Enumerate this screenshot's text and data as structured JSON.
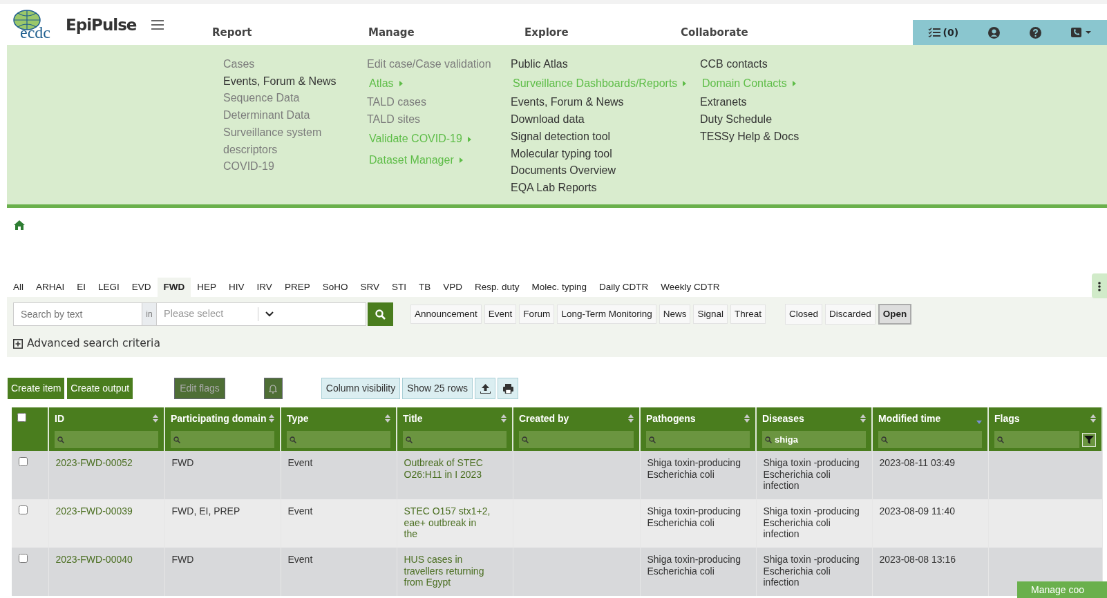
{
  "brand": {
    "logo_text": "ecdc",
    "name": "EpiPulse"
  },
  "menu_heads": [
    "Report",
    "Manage",
    "Explore",
    "Collaborate"
  ],
  "toolbar": {
    "task_count": "(0)"
  },
  "menu_columns": [
    [
      {
        "label": "Cases",
        "kind": "muted"
      },
      {
        "label": "Events, Forum & News",
        "kind": "link"
      },
      {
        "label": "Sequence Data",
        "kind": "muted"
      },
      {
        "label": "Determinant Data",
        "kind": "muted"
      },
      {
        "label": "Surveillance system descriptors",
        "kind": "muted"
      },
      {
        "label": "COVID-19",
        "kind": "muted"
      }
    ],
    [
      {
        "label": "Edit case/Case validation",
        "kind": "muted"
      },
      {
        "label": "Atlas",
        "kind": "submenu"
      },
      {
        "label": "TALD cases",
        "kind": "muted"
      },
      {
        "label": "TALD sites",
        "kind": "muted"
      },
      {
        "label": "Validate COVID-19",
        "kind": "submenu"
      },
      {
        "label": "Dataset Manager",
        "kind": "submenu"
      }
    ],
    [
      {
        "label": "Public Atlas",
        "kind": "link"
      },
      {
        "label": "Surveillance Dashboards/Reports",
        "kind": "submenu"
      },
      {
        "label": "Events, Forum & News",
        "kind": "link"
      },
      {
        "label": "Download data",
        "kind": "link"
      },
      {
        "label": "Signal detection tool",
        "kind": "link"
      },
      {
        "label": "Molecular typing tool",
        "kind": "link"
      },
      {
        "label": "Documents Overview",
        "kind": "link"
      },
      {
        "label": "EQA Lab Reports",
        "kind": "link"
      }
    ],
    [
      {
        "label": "CCB contacts",
        "kind": "link"
      },
      {
        "label": "Domain Contacts",
        "kind": "submenu"
      },
      {
        "label": "Extranets",
        "kind": "link"
      },
      {
        "label": "Duty Schedule",
        "kind": "link"
      },
      {
        "label": "TESSy Help & Docs",
        "kind": "link"
      }
    ]
  ],
  "domain_tabs": [
    {
      "label": "All",
      "selected": false
    },
    {
      "label": "ARHAI",
      "selected": false
    },
    {
      "label": "EI",
      "selected": false
    },
    {
      "label": "LEGI",
      "selected": false
    },
    {
      "label": "EVD",
      "selected": false
    },
    {
      "label": "FWD",
      "selected": true
    },
    {
      "label": "HEP",
      "selected": false
    },
    {
      "label": "HIV",
      "selected": false
    },
    {
      "label": "IRV",
      "selected": false
    },
    {
      "label": "PREP",
      "selected": false
    },
    {
      "label": "SoHO",
      "selected": false
    },
    {
      "label": "SRV",
      "selected": false
    },
    {
      "label": "STI",
      "selected": false
    },
    {
      "label": "TB",
      "selected": false
    },
    {
      "label": "VPD",
      "selected": false
    },
    {
      "label": "Resp. duty",
      "selected": false
    },
    {
      "label": "Molec. typing",
      "selected": false
    },
    {
      "label": "Daily CDTR",
      "selected": false
    },
    {
      "label": "Weekly CDTR",
      "selected": false
    }
  ],
  "search": {
    "placeholder": "Search by text",
    "in_label": "in",
    "select_placeholder": "Please select",
    "advanced": "Advanced search criteria"
  },
  "type_filters": [
    {
      "label": "Announcement",
      "selected": false
    },
    {
      "label": "Event",
      "selected": false
    },
    {
      "label": "Forum",
      "selected": false
    },
    {
      "label": "Long-Term Monitoring",
      "selected": false
    },
    {
      "label": "News",
      "selected": false
    },
    {
      "label": "Signal",
      "selected": false
    },
    {
      "label": "Threat",
      "selected": false
    }
  ],
  "status_filters": [
    {
      "label": "Closed",
      "selected": false
    },
    {
      "label": "Discarded",
      "selected": false
    },
    {
      "label": "Open",
      "selected": true
    }
  ],
  "actions": {
    "create_item": "Create item",
    "create_output": "Create output",
    "edit_flags": "Edit flags",
    "column_visibility": "Column visibility",
    "show_rows": "Show 25 rows"
  },
  "table": {
    "all_checked": false,
    "columns": [
      {
        "label": "ID",
        "sorted_desc": false
      },
      {
        "label": "Participating domain",
        "sorted_desc": false
      },
      {
        "label": "Type",
        "sorted_desc": false
      },
      {
        "label": "Title",
        "sorted_desc": false
      },
      {
        "label": "Created by",
        "sorted_desc": false
      },
      {
        "label": "Pathogens",
        "sorted_desc": false
      },
      {
        "label": "Diseases",
        "sorted_desc": false,
        "filter": "shiga"
      },
      {
        "label": "Modified time",
        "sorted_desc": true
      },
      {
        "label": "Flags",
        "sorted_desc": false
      }
    ],
    "rows": [
      {
        "checked": false,
        "cells": [
          "2023-FWD-00052",
          "FWD",
          "Event",
          "Outbreak of STEC O26:H11 in I 2023",
          "",
          "Shiga toxin-producing Escherichia coli",
          "Shiga toxin -producing Escherichia coli infection",
          "2023-08-11 03:49",
          ""
        ]
      },
      {
        "checked": false,
        "cells": [
          "2023-FWD-00039",
          "FWD, EI, PREP",
          "Event",
          "STEC O157 stx1+2, eae+ outbreak in the",
          "",
          "Shiga toxin-producing Escherichia coli",
          "Shiga toxin -producing Escherichia coli infection",
          "2023-08-09 11:40",
          ""
        ]
      },
      {
        "checked": false,
        "cells": [
          "2023-FWD-00040",
          "FWD",
          "Event",
          "HUS cases in travellers returning from Egypt",
          "",
          "Shiga toxin-producing Escherichia coli",
          "Shiga toxin -producing Escherichia coli infection",
          "2023-08-08 13:16",
          ""
        ]
      }
    ]
  },
  "cookie_button": "Manage coo"
}
